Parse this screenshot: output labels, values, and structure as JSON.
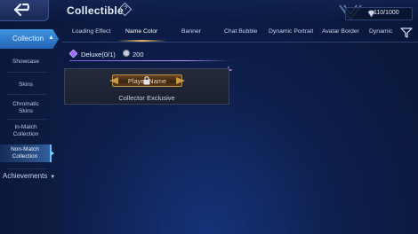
{
  "header": {
    "title": "Collectible",
    "help_icon": "diamond-help-icon",
    "counter": "110/1000",
    "counter_icon": "gem-icon"
  },
  "sidebar": {
    "section_label": "Collection",
    "items": [
      {
        "label": "Showcase"
      },
      {
        "label": "Skins"
      },
      {
        "label": "Chromatic Skins"
      },
      {
        "label": "In-Match Collection"
      },
      {
        "label": "Non-Match Collection"
      }
    ],
    "achievements_label": "Achievements"
  },
  "tabs": [
    {
      "label": "Loading Effect"
    },
    {
      "label": "Name Color"
    },
    {
      "label": "Banner"
    },
    {
      "label": "Chat Bubble"
    },
    {
      "label": "Dynamic Portrait"
    },
    {
      "label": "Avatar Border"
    },
    {
      "label": "Dynamic"
    }
  ],
  "active_tab": "Name Color",
  "group": {
    "label": "Deluxe(0/1)",
    "cost": "200"
  },
  "card": {
    "plate_text": "Player Name",
    "caption": "Collector Exclusive"
  },
  "colors": {
    "accent_blue": "#3f97e0",
    "gold": "#e0b65a",
    "deluxe_purple": "#9b6cff"
  }
}
